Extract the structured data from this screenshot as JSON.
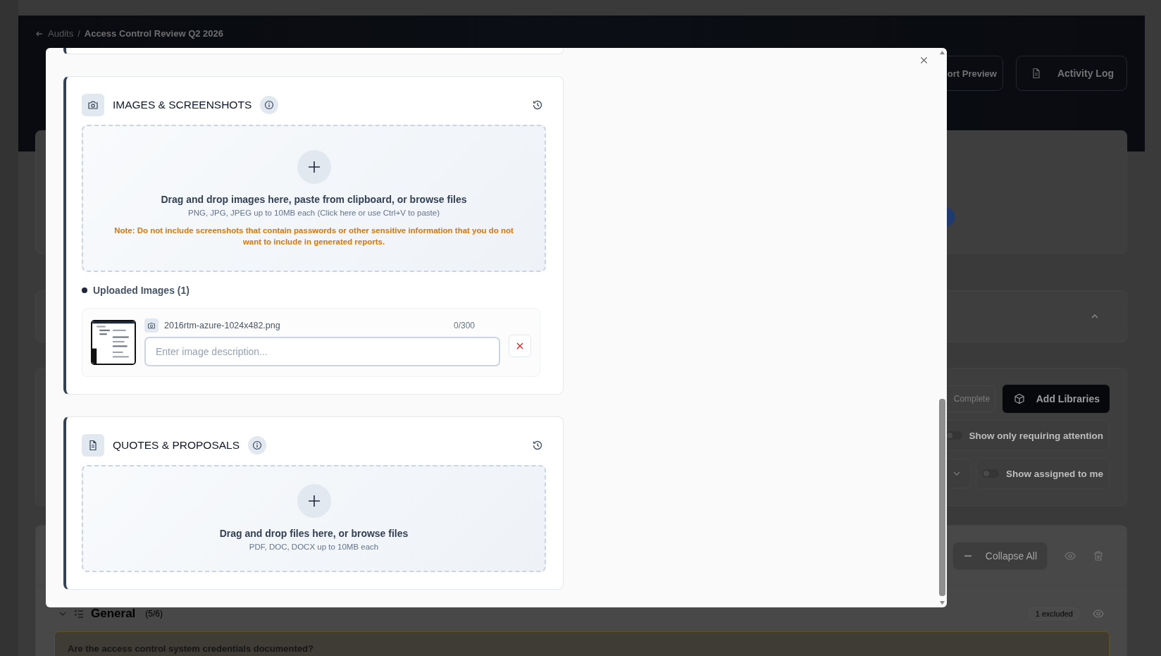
{
  "background": {
    "breadcrumb": {
      "back_label": "Audits",
      "separator": "/",
      "current": "Access Control Review Q2 2026"
    },
    "header_buttons": [
      {
        "kind": "preview",
        "label": "ort Preview"
      },
      {
        "kind": "log",
        "label": "Activity Log"
      }
    ],
    "status_chip": "Complete",
    "add_button": "Add Libraries",
    "toggles": [
      {
        "label": "Show only requiring attention",
        "on": false,
        "dropdown": false
      },
      {
        "label": "Show assigned to me",
        "on": false,
        "dropdown": true
      }
    ],
    "collapse_button": "Collapse All",
    "section": {
      "title": "General",
      "count": "(5/6)",
      "expanded": true,
      "excluded": "1 excluded"
    },
    "question": "Are the access control system credentials documented?"
  },
  "modal": {
    "sections": [
      {
        "kind": "images",
        "title": "IMAGES & SCREENSHOTS",
        "prompt": "Drag and drop images here, paste from clipboard, or browse files",
        "hint": "PNG, JPG, JPEG up to 10MB each (Click here or use Ctrl+V to paste)",
        "note": "Note: Do not include screenshots that contain passwords or other sensitive information that you do not want to include in generated reports.",
        "uploaded_heading": "Uploaded Images (1)",
        "uploads": [
          {
            "filename": "2016rtm-azure-1024x482.png",
            "counter": "0/300",
            "placeholder": "Enter image description..."
          }
        ]
      },
      {
        "kind": "quotes",
        "title": "QUOTES & PROPOSALS",
        "prompt": "Drag and drop files here, or browse files",
        "hint": "PDF, DOC, DOCX up to 10MB each"
      }
    ]
  }
}
